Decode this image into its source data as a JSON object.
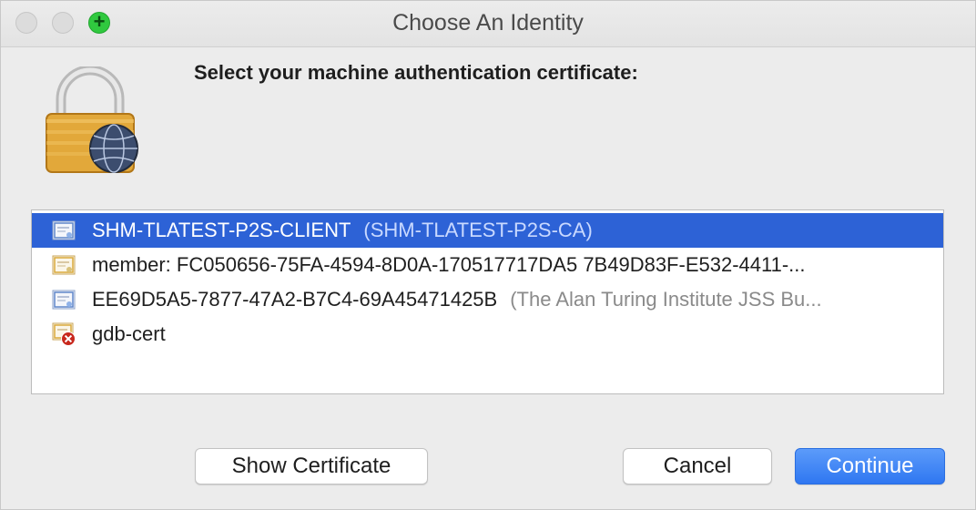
{
  "window": {
    "title": "Choose An Identity"
  },
  "prompt": "Select your machine authentication certificate:",
  "identities": [
    {
      "name": "SHM-TLATEST-P2S-CLIENT",
      "detail": "(SHM-TLATEST-P2S-CA)",
      "icon": "certificate-blue-icon",
      "selected": true
    },
    {
      "name": "member: FC050656-75FA-4594-8D0A-170517717DA5 7B49D83F-E532-4411-...",
      "detail": "",
      "icon": "certificate-gold-icon",
      "selected": false
    },
    {
      "name": "EE69D5A5-7877-47A2-B7C4-69A45471425B",
      "detail": "(The Alan Turing Institute JSS Bu...",
      "icon": "certificate-blue-icon",
      "selected": false
    },
    {
      "name": "gdb-cert",
      "detail": "",
      "icon": "certificate-invalid-icon",
      "selected": false
    }
  ],
  "buttons": {
    "show_certificate": "Show Certificate",
    "cancel": "Cancel",
    "continue": "Continue"
  },
  "colors": {
    "selection": "#2d62d6",
    "primary_button": "#2f77f1",
    "zoom_button": "#30c93f"
  }
}
